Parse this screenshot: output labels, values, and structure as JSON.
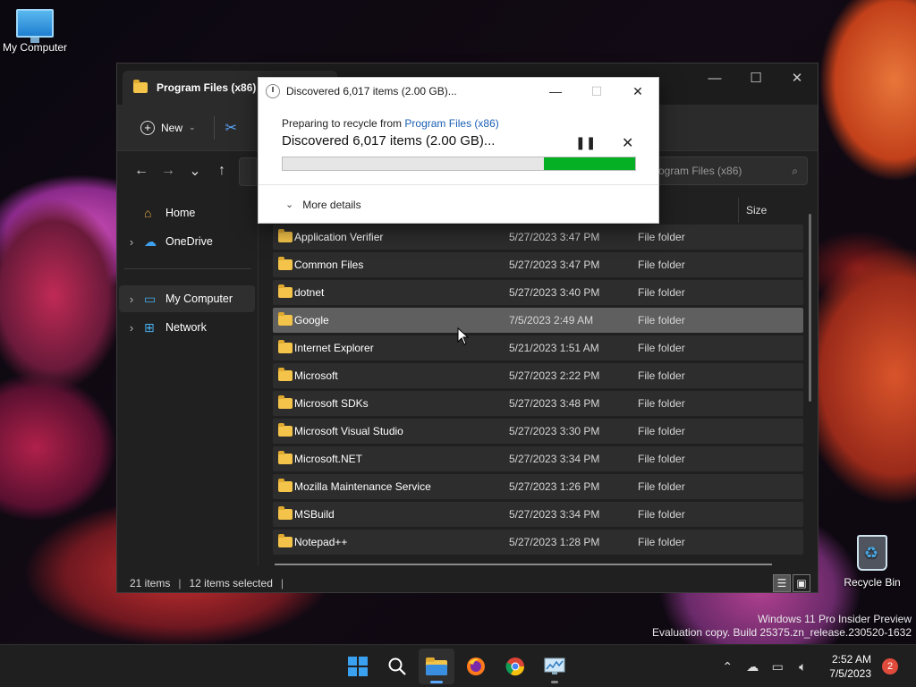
{
  "desktop": {
    "my_computer_label": "My Computer",
    "recycle_bin_label": "Recycle Bin"
  },
  "explorer": {
    "tab_title": "Program Files (x86)",
    "new_label": "New",
    "search_placeholder": "h Program Files (x86)",
    "column_size": "Size",
    "sidebar": {
      "home": "Home",
      "onedrive": "OneDrive",
      "my_computer": "My Computer",
      "network": "Network"
    },
    "rows": [
      {
        "name": "Application Verifier",
        "date": "5/27/2023 3:47 PM",
        "type": "File folder"
      },
      {
        "name": "Common Files",
        "date": "5/27/2023 3:47 PM",
        "type": "File folder"
      },
      {
        "name": "dotnet",
        "date": "5/27/2023 3:40 PM",
        "type": "File folder"
      },
      {
        "name": "Google",
        "date": "7/5/2023 2:49 AM",
        "type": "File folder"
      },
      {
        "name": "Internet Explorer",
        "date": "5/21/2023 1:51 AM",
        "type": "File folder"
      },
      {
        "name": "Microsoft",
        "date": "5/27/2023 2:22 PM",
        "type": "File folder"
      },
      {
        "name": "Microsoft SDKs",
        "date": "5/27/2023 3:48 PM",
        "type": "File folder"
      },
      {
        "name": "Microsoft Visual Studio",
        "date": "5/27/2023 3:30 PM",
        "type": "File folder"
      },
      {
        "name": "Microsoft.NET",
        "date": "5/27/2023 3:34 PM",
        "type": "File folder"
      },
      {
        "name": "Mozilla Maintenance Service",
        "date": "5/27/2023 1:26 PM",
        "type": "File folder"
      },
      {
        "name": "MSBuild",
        "date": "5/27/2023 3:34 PM",
        "type": "File folder"
      },
      {
        "name": "Notepad++",
        "date": "5/27/2023 1:28 PM",
        "type": "File folder"
      }
    ],
    "selected_row": 3,
    "status": {
      "items": "21 items",
      "selected": "12 items selected"
    }
  },
  "dialog": {
    "title": "Discovered 6,017 items (2.00 GB)...",
    "preparing_prefix": "Preparing to recycle from ",
    "preparing_link": "Program Files (x86)",
    "main_line": "Discovered 6,017 items (2.00 GB)...",
    "progress_start": 0.74,
    "progress_end": 1.0,
    "more_details": "More details"
  },
  "watermark": {
    "line1": "Windows 11 Pro Insider Preview",
    "line2": "Evaluation copy. Build 25375.zn_release.230520-1632"
  },
  "taskbar": {
    "time": "2:52 AM",
    "date": "7/5/2023",
    "notification_count": "2"
  },
  "colors": {
    "progress_green": "#06b025",
    "accent": "#3aa0f0",
    "selected_row": "#5f5f5f"
  }
}
